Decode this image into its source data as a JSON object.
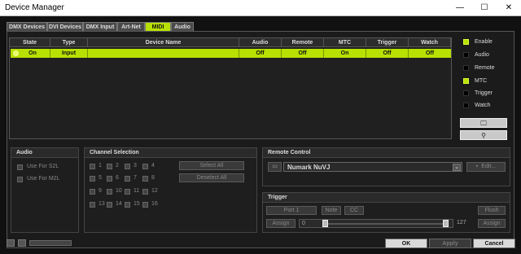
{
  "window": {
    "title": "Device Manager",
    "min": "—",
    "max": "☐",
    "close": "✕"
  },
  "tabs": [
    "DMX Devices",
    "DVI Devices",
    "DMX Input",
    "Art-Net",
    "MIDI",
    "Audio"
  ],
  "active_tab": "MIDI",
  "table": {
    "headers": [
      "State",
      "Type",
      "Device Name",
      "Audio",
      "Remote",
      "MTC",
      "Trigger",
      "Watch"
    ],
    "rows": [
      {
        "state": "On",
        "type": "Input",
        "name": "",
        "audio": "Off",
        "remote": "Off",
        "mtc": "On",
        "trigger": "Off",
        "watch": "Off"
      }
    ]
  },
  "side_options": [
    {
      "label": "Enable",
      "on": true
    },
    {
      "label": "Audio",
      "on": false
    },
    {
      "label": "Remote",
      "on": false
    },
    {
      "label": "MTC",
      "on": true
    },
    {
      "label": "Trigger",
      "on": false
    },
    {
      "label": "Watch",
      "on": false
    }
  ],
  "audio_panel": {
    "title": "Audio",
    "use_s2l": "Use For S2L",
    "use_m2l": "Use For M2L"
  },
  "channel_panel": {
    "title": "Channel Selection",
    "channels": [
      "1",
      "2",
      "3",
      "4",
      "5",
      "6",
      "7",
      "8",
      "9",
      "10",
      "11",
      "12",
      "13",
      "14",
      "15",
      "16"
    ],
    "select_all": "Select All",
    "deselect_all": "Deselect All"
  },
  "remote_panel": {
    "title": "Remote Control",
    "device": "Numark NuVJ",
    "edit": "Edit..."
  },
  "trigger_panel": {
    "title": "Trigger",
    "port": "Port 1",
    "note": "Note",
    "cc": "CC",
    "flush": "Flush",
    "assign_left": "Assign",
    "assign_right": "Assign",
    "min": "0",
    "max": "127"
  },
  "footer": {
    "ok": "OK",
    "apply": "Apply",
    "cancel": "Cancel"
  },
  "colors": {
    "accent": "#b8e000"
  }
}
